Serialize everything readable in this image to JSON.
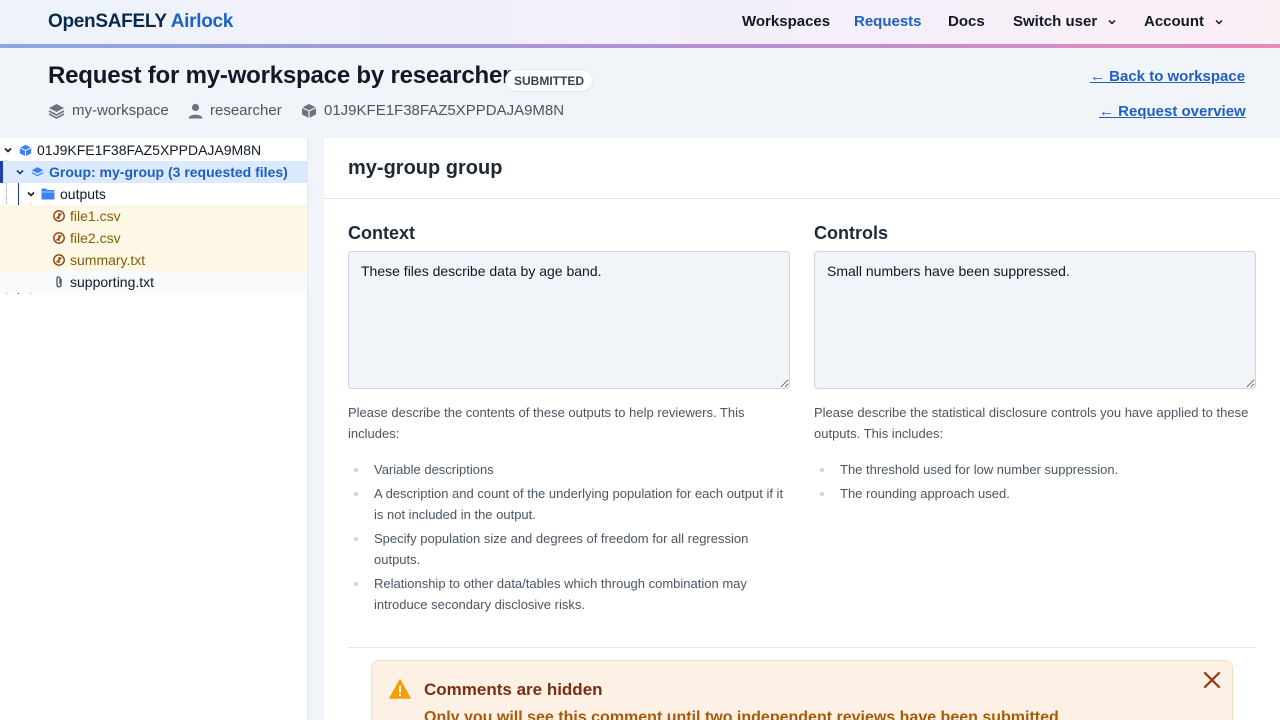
{
  "brand": {
    "part1": "OpenSAFELY",
    "part2": "Airlock"
  },
  "nav": {
    "workspaces": "Workspaces",
    "requests": "Requests",
    "docs": "Docs",
    "switch_user": "Switch user",
    "account": "Account"
  },
  "request": {
    "title": "Request for my-workspace by researcher",
    "status": "SUBMITTED",
    "workspace": "my-workspace",
    "user": "researcher",
    "id": "01J9KFE1F38FAZ5XPPDAJA9M8N",
    "back_link": "← Back to workspace",
    "overview_link": "← Request overview"
  },
  "tree": {
    "root": "01J9KFE1F38FAZ5XPPDAJA9M8N",
    "group": "Group: my-group (3 requested files)",
    "folder": "outputs",
    "files": [
      "file1.csv",
      "file2.csv",
      "summary.txt"
    ],
    "supporting": "supporting.txt"
  },
  "group": {
    "title": "my-group group",
    "context": {
      "heading": "Context",
      "value": "These files describe data by age band.",
      "help": "Please describe the contents of these outputs to help reviewers. This includes:",
      "items": [
        "Variable descriptions",
        "A description and count of the underlying population for each output if it is not included in the output.",
        "Specify population size and degrees of freedom for all regression outputs.",
        "Relationship to other data/tables which through combination may introduce secondary disclosive risks."
      ]
    },
    "controls": {
      "heading": "Controls",
      "value": "Small numbers have been suppressed.",
      "help": "Please describe the statistical disclosure controls you have applied to these outputs. This includes:",
      "items": [
        "The threshold used for low number suppression.",
        "The rounding approach used."
      ]
    }
  },
  "alert": {
    "title": "Comments are hidden",
    "body": "Only you will see this comment until two independent reviews have been submitted"
  },
  "colors": {
    "accent": "#1f5fbf",
    "warning": "#f59e0b",
    "highlight_file": "#fef9e7",
    "highlight_group": "#dbeafe"
  },
  "icons": [
    "chevron-down-icon",
    "layers-icon",
    "user-icon",
    "cube-icon",
    "folder-icon",
    "file-changed-icon",
    "paperclip-icon",
    "warning-icon",
    "close-icon"
  ]
}
